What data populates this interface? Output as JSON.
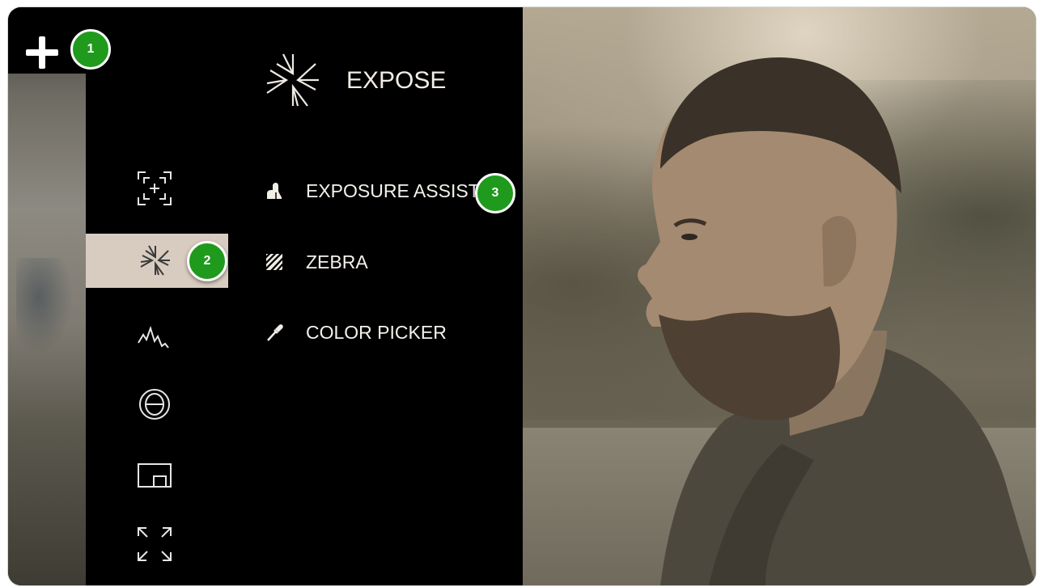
{
  "menu": {
    "title": "EXPOSE",
    "items": [
      {
        "label": "EXPOSURE ASSIST",
        "icon": "exposure-assist-icon"
      },
      {
        "label": "ZEBRA",
        "icon": "zebra-icon"
      },
      {
        "label": "COLOR PICKER",
        "icon": "color-picker-icon"
      }
    ]
  },
  "sidebar": {
    "icons": [
      "focus-icon",
      "expose-icon",
      "waveform-icon",
      "theta-icon",
      "pip-icon",
      "fullscreen-icon"
    ],
    "selected": "expose-icon"
  },
  "badges": [
    "1",
    "2",
    "3"
  ],
  "colors": {
    "selected_bg": "#d8ccc1",
    "badge": "#1f9a1c",
    "panel_bg": "#000000"
  }
}
